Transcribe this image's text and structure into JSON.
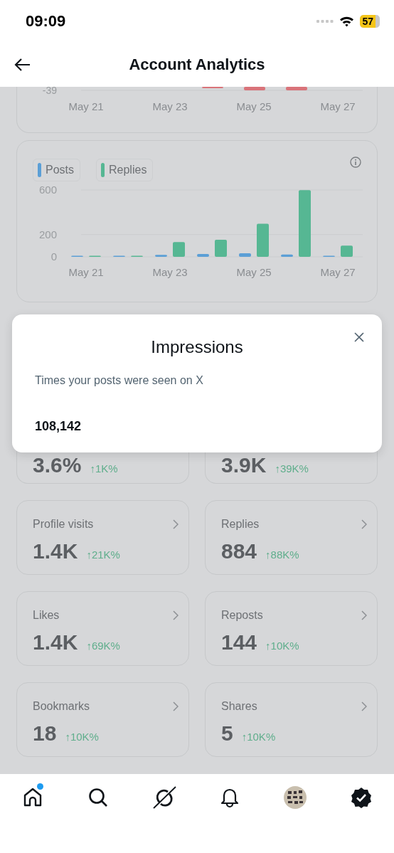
{
  "status_bar": {
    "time": "09:09",
    "battery": "57"
  },
  "header": {
    "title": "Account Analytics"
  },
  "net_chart": {
    "y_tick": "-39",
    "x_labels": [
      "May 21",
      "May 23",
      "May 25",
      "May 27"
    ]
  },
  "activity_chart": {
    "chart_data": {
      "type": "bar",
      "categories": [
        "May 21",
        null,
        "May 23",
        null,
        "May 25",
        null,
        "May 27"
      ],
      "series": [
        {
          "name": "Posts",
          "color": "#5b9fd6",
          "values": [
            4,
            5,
            18,
            25,
            32,
            20,
            2
          ]
        },
        {
          "name": "Replies",
          "color": "#56b793",
          "values": [
            1,
            8,
            132,
            153,
            297,
            598,
            100
          ]
        }
      ],
      "ylim": [
        0,
        600
      ],
      "yticks": [
        0,
        200,
        600
      ]
    }
  },
  "metrics": [
    {
      "value": "3.6%",
      "change": "↑1K%"
    },
    {
      "value": "3.9K",
      "change": "↑39K%"
    },
    {
      "label": "Profile visits",
      "value": "1.4K",
      "change": "↑21K%"
    },
    {
      "label": "Replies",
      "value": "884",
      "change": "↑88K%"
    },
    {
      "label": "Likes",
      "value": "1.4K",
      "change": "↑69K%"
    },
    {
      "label": "Reposts",
      "value": "144",
      "change": "↑10K%"
    },
    {
      "label": "Bookmarks",
      "value": "18",
      "change": "↑10K%"
    },
    {
      "label": "Shares",
      "value": "5",
      "change": "↑10K%"
    }
  ],
  "dialog": {
    "title": "Impressions",
    "description": "Times your posts were seen on X",
    "value": "108,142"
  },
  "nav": {
    "items": [
      {
        "kind": "home",
        "dot": true
      },
      {
        "kind": "search",
        "dot": false
      },
      {
        "kind": "grok",
        "dot": false
      },
      {
        "kind": "notifications",
        "dot": false
      },
      {
        "kind": "avatar",
        "dot": false
      },
      {
        "kind": "verified",
        "dot": false
      }
    ]
  }
}
